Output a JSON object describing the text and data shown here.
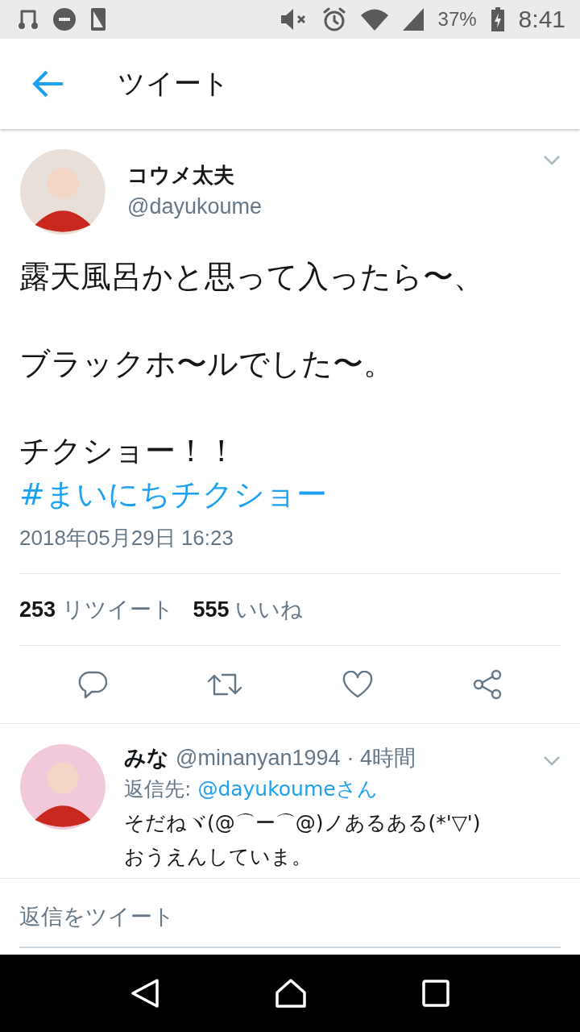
{
  "status_bar": {
    "battery": "37%",
    "time": "8:41"
  },
  "header": {
    "title": "ツイート"
  },
  "tweet": {
    "name": "コウメ太夫",
    "handle": "@dayukoume",
    "paragraphs": [
      {
        "text": "露天風呂かと思って入ったら〜、"
      },
      {
        "text": "ブラックホ〜ルでした〜。"
      },
      {
        "text": "チクショー！！　",
        "hashtag": "#まいにちチクショー"
      }
    ],
    "timestamp": "2018年05月29日 16:23",
    "stats": [
      {
        "count": "253",
        "label": "リツイート"
      },
      {
        "count": "555",
        "label": "いいね"
      }
    ]
  },
  "replies": [
    {
      "name": "みな",
      "handle": "@minanyan1994",
      "time": "· 4時間",
      "reply_to_label": "返信先:",
      "reply_to": "@dayukoumeさん",
      "lines": [
        "そだねヾ(@⌒ー⌒@)ノあるある(*'▽')",
        "おうえんしていま。"
      ]
    }
  ],
  "composer": {
    "placeholder": "返信をツイート"
  }
}
